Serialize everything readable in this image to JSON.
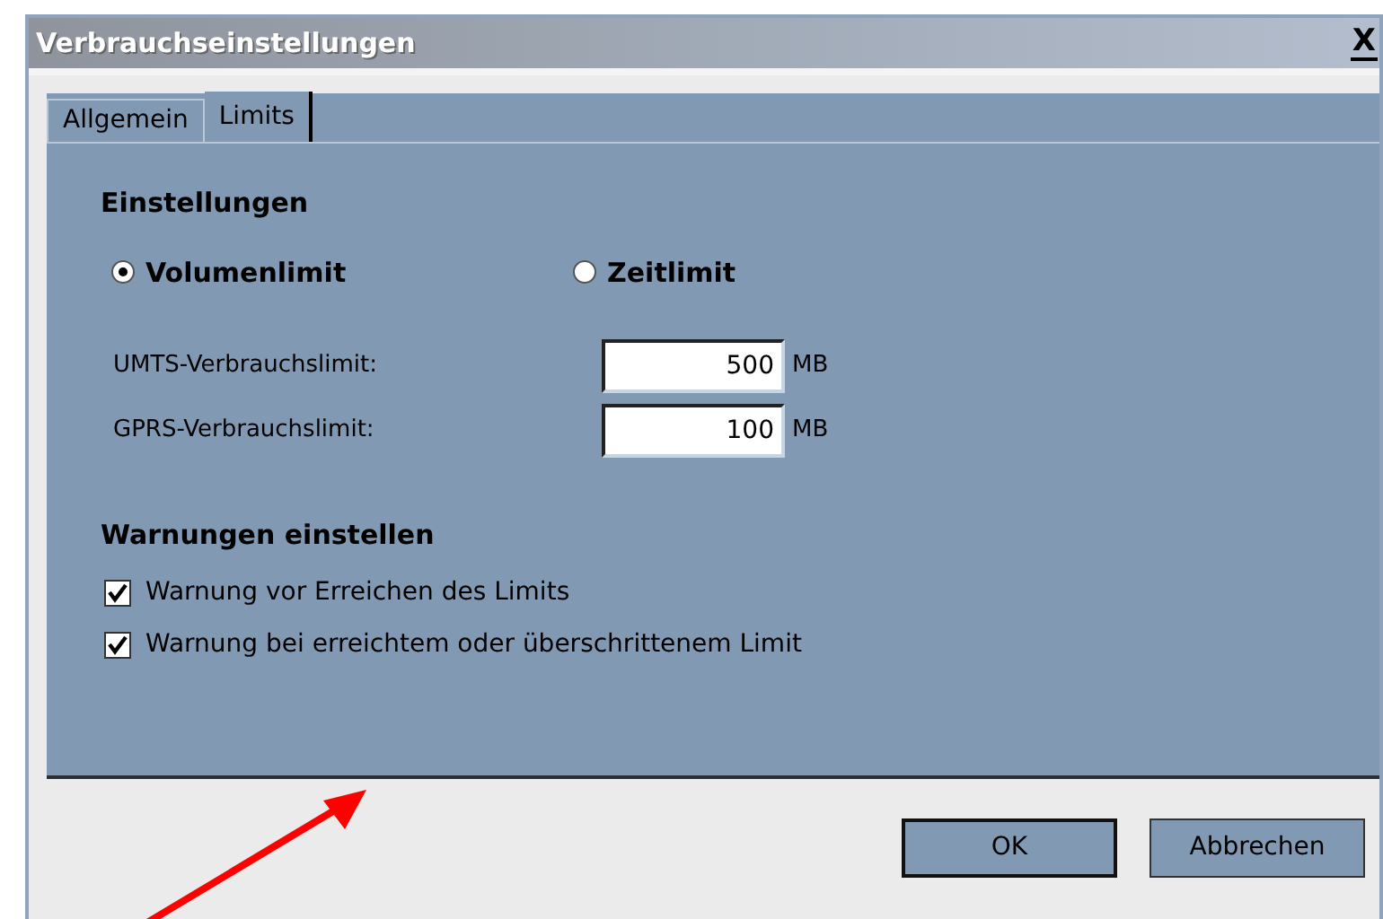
{
  "window": {
    "title": "Verbrauchseinstellungen",
    "close": "X"
  },
  "tabs": [
    {
      "label": "Allgemein",
      "selected": false
    },
    {
      "label": "Limits",
      "selected": true
    }
  ],
  "settings": {
    "heading": "Einstellungen",
    "modes": [
      {
        "label": "Volumenlimit",
        "selected": true
      },
      {
        "label": "Zeitlimit",
        "selected": false
      }
    ],
    "fields": [
      {
        "label": "UMTS-Verbrauchslimit:",
        "value": "500",
        "unit": "MB"
      },
      {
        "label": "GPRS-Verbrauchslimit:",
        "value": "100",
        "unit": "MB"
      }
    ]
  },
  "warnings": {
    "heading": "Warnungen einstellen",
    "options": [
      {
        "label": "Warnung vor Erreichen des Limits",
        "checked": true
      },
      {
        "label": "Warnung bei erreichtem oder überschrittenem Limit",
        "checked": true
      }
    ]
  },
  "buttons": [
    {
      "label": "OK",
      "default": true
    },
    {
      "label": "Abbrechen",
      "default": false
    }
  ]
}
